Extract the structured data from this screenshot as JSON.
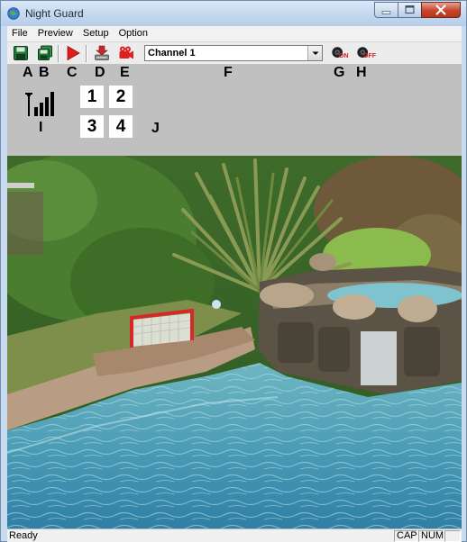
{
  "window": {
    "title": "Night Guard"
  },
  "menu": {
    "items": [
      {
        "label": "File"
      },
      {
        "label": "Preview"
      },
      {
        "label": "Setup"
      },
      {
        "label": "Option"
      }
    ]
  },
  "toolbar": {
    "icons": {
      "save": "save-icon",
      "save_all": "save-all-icon",
      "play": "play-icon",
      "download": "download-icon",
      "record": "video-camera-icon",
      "alarm_on": "alarm-on-icon",
      "alarm_off": "alarm-off-icon"
    },
    "alarm_on_text": "ON",
    "alarm_off_text": "OFF",
    "channel_select": {
      "value": "Channel 1"
    }
  },
  "labels": {
    "a": "A",
    "b": "B",
    "c": "C",
    "d": "D",
    "e": "E",
    "f": "F",
    "g": "G",
    "h": "H",
    "i": "I",
    "j": "J"
  },
  "quad_buttons": [
    "1",
    "2",
    "3",
    "4"
  ],
  "status": {
    "text": "Ready",
    "cap": "CAP",
    "num": "NUM"
  },
  "colors": {
    "record_red": "#e02020",
    "play_red": "#e21b1b",
    "save_green": "#1f7a3a"
  }
}
